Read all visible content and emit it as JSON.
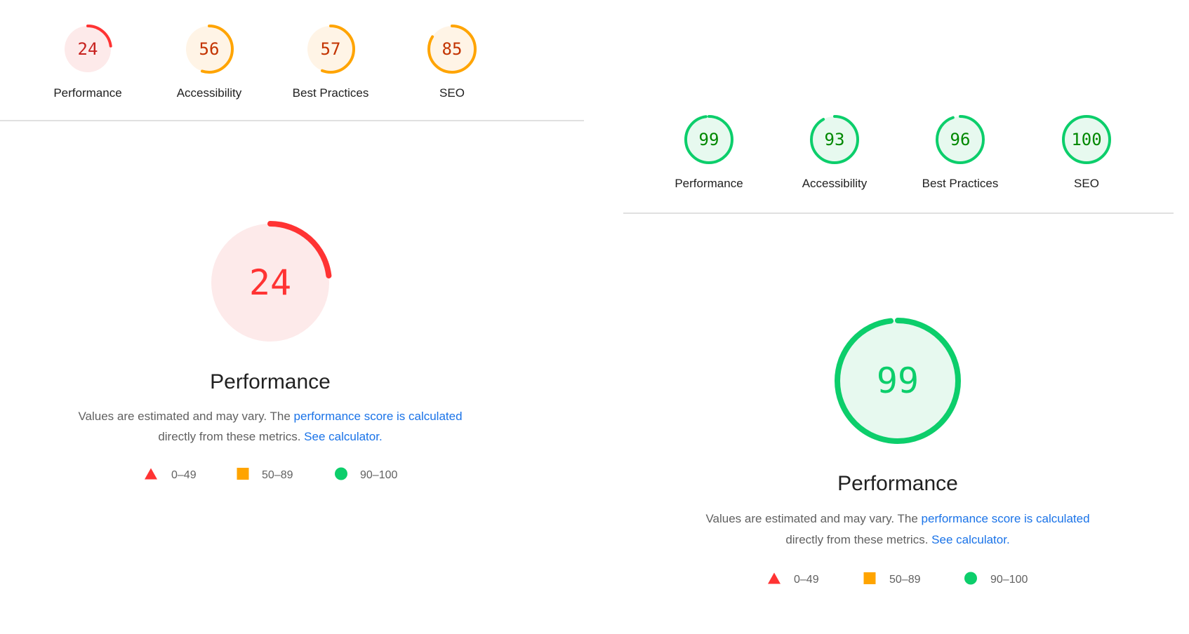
{
  "colors": {
    "fail": "#ff3333",
    "fail_bg": "#fdeaea",
    "fail_text": "#c7221f",
    "average": "#ffa400",
    "average_bg": "#fff4e6",
    "average_text": "#c33300",
    "pass": "#0cce6b",
    "pass_bg": "#e7f9ef",
    "pass_text": "#008800",
    "link": "#1a73e8"
  },
  "reports": [
    {
      "categories": [
        {
          "label": "Performance",
          "score": 24,
          "rating": "fail"
        },
        {
          "label": "Accessibility",
          "score": 56,
          "rating": "average"
        },
        {
          "label": "Best Practices",
          "score": 57,
          "rating": "average"
        },
        {
          "label": "SEO",
          "score": 85,
          "rating": "average"
        }
      ],
      "main": {
        "title": "Performance",
        "score": 24,
        "rating": "fail"
      },
      "description": {
        "text1": "Values are estimated and may vary. The ",
        "link1": "performance score is calculated",
        "text2": "directly from these metrics. ",
        "link2": "See calculator."
      },
      "legend": [
        {
          "icon": "triangle-icon",
          "range": "0–49"
        },
        {
          "icon": "square-icon",
          "range": "50–89"
        },
        {
          "icon": "circle-icon",
          "range": "90–100"
        }
      ]
    },
    {
      "categories": [
        {
          "label": "Performance",
          "score": 99,
          "rating": "pass"
        },
        {
          "label": "Accessibility",
          "score": 93,
          "rating": "pass"
        },
        {
          "label": "Best Practices",
          "score": 96,
          "rating": "pass"
        },
        {
          "label": "SEO",
          "score": 100,
          "rating": "pass"
        }
      ],
      "main": {
        "title": "Performance",
        "score": 99,
        "rating": "pass"
      },
      "description": {
        "text1": "Values are estimated and may vary. The ",
        "link1": "performance score is calculated",
        "text2": "directly from these metrics. ",
        "link2": "See calculator."
      },
      "legend": [
        {
          "icon": "triangle-icon",
          "range": "0–49"
        },
        {
          "icon": "square-icon",
          "range": "50–89"
        },
        {
          "icon": "circle-icon",
          "range": "90–100"
        }
      ]
    }
  ]
}
